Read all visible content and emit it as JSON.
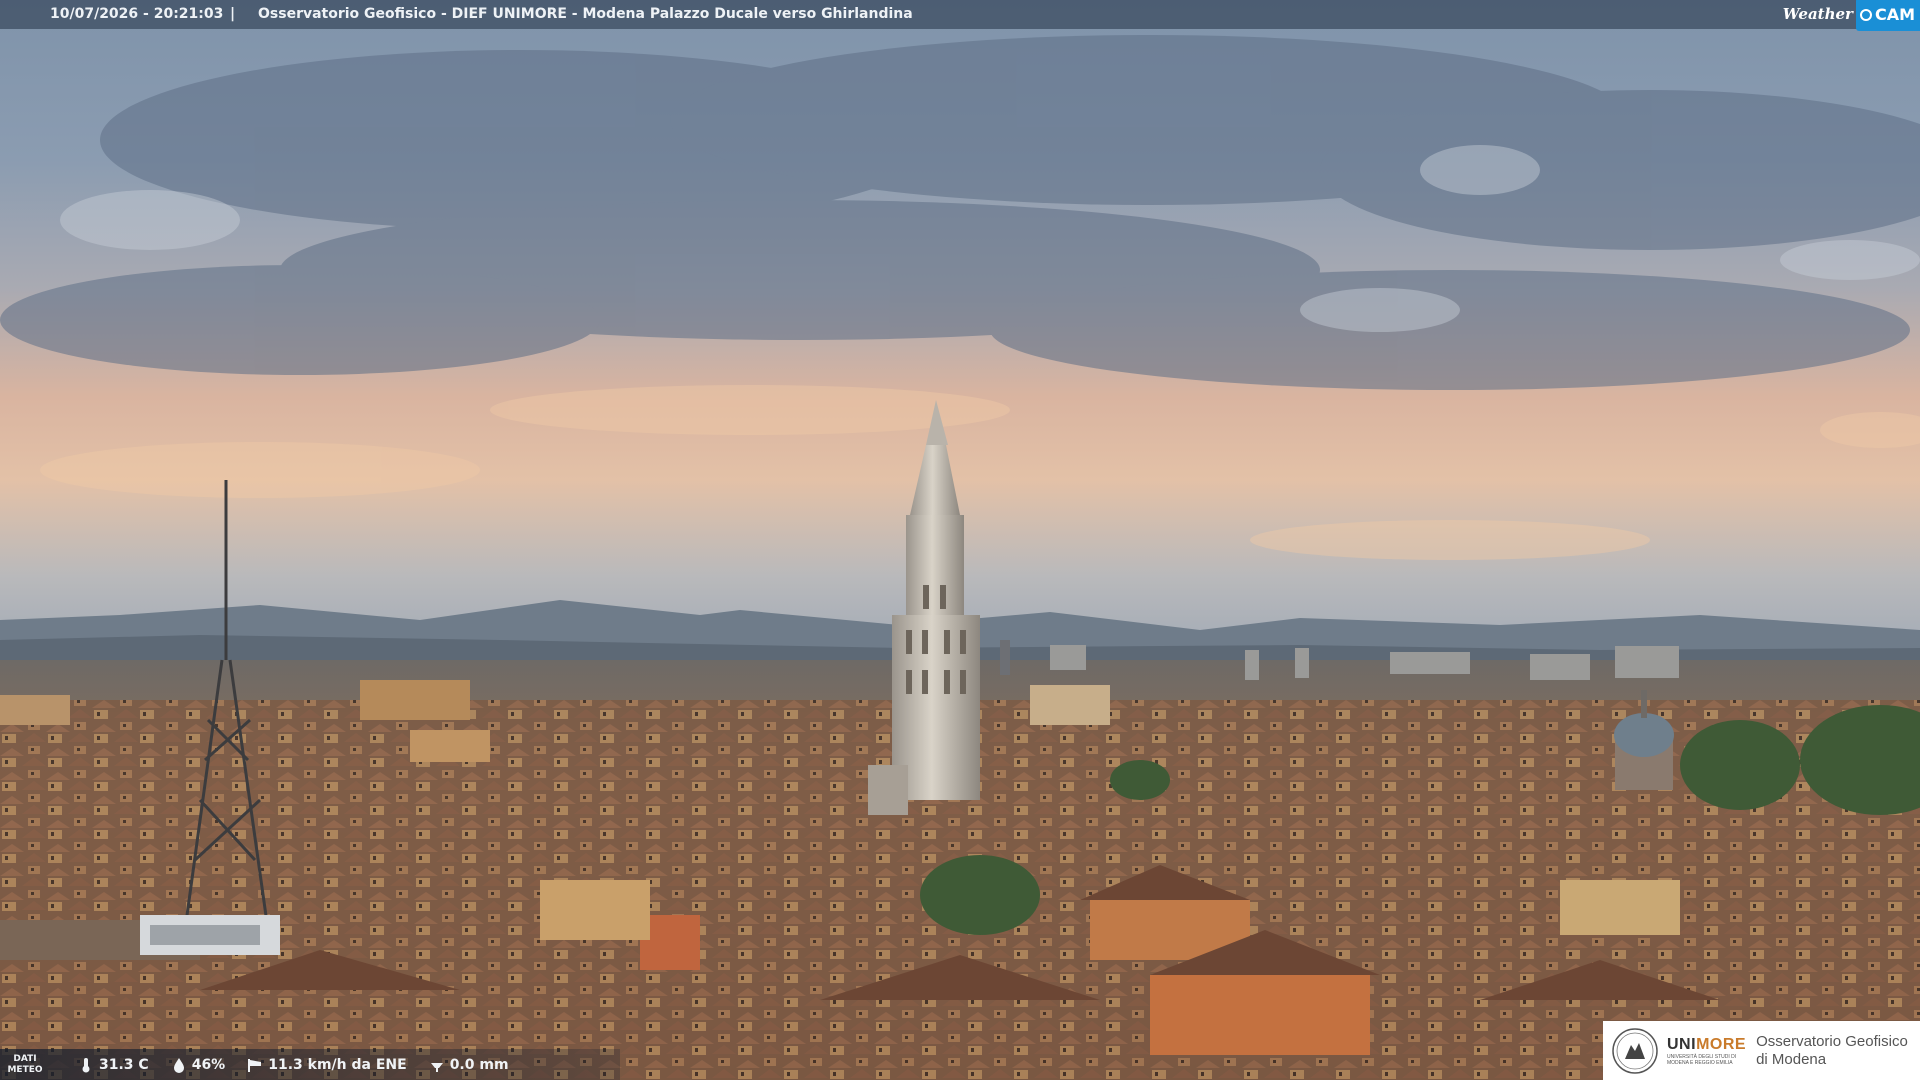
{
  "header": {
    "timestamp": "10/07/2026 - 20:21:03",
    "separator": "|",
    "title": "Osservatorio Geofisico - DIEF UNIMORE - Modena Palazzo Ducale verso Ghirlandina"
  },
  "brand": {
    "weather": "Weather",
    "cam": "CAM",
    "accent_color": "#1a8fd6"
  },
  "meteo": {
    "label_line1": "DATI",
    "label_line2": "METEO",
    "temperature": "31.3 C",
    "humidity": "46%",
    "wind": "11.3 km/h da ENE",
    "rain": "0.0 mm",
    "icons": [
      "thermometer-icon",
      "humidity-drop-icon",
      "wind-sock-icon",
      "rain-gauge-icon"
    ]
  },
  "logo": {
    "uni_prefix": "UNI",
    "uni_suffix": "MORE",
    "uni_sub1": "UNIVERSITÀ DEGLI STUDI DI",
    "uni_sub2": "MODENA E REGGIO EMILIA",
    "observatory_line1": "Osservatorio Geofisico",
    "observatory_line2": "di Modena"
  }
}
